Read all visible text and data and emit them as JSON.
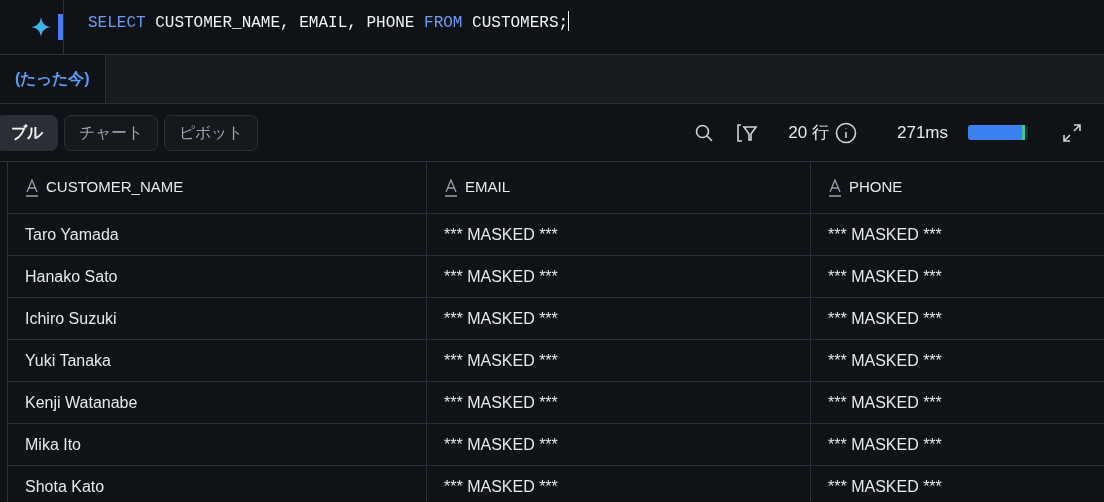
{
  "editor": {
    "query_tokens": [
      {
        "text": "SELECT",
        "kind": "keyword"
      },
      {
        "text": " CUSTOMER_NAME, EMAIL, PHONE ",
        "kind": "plain"
      },
      {
        "text": "FROM",
        "kind": "keyword"
      },
      {
        "text": " CUSTOMERS;",
        "kind": "plain"
      }
    ]
  },
  "result_tabs": [
    {
      "label": "(たった今)",
      "selected": true
    }
  ],
  "view_tabs": [
    {
      "label": "ブル",
      "selected": true
    },
    {
      "label": "チャート",
      "selected": false
    },
    {
      "label": "ピボット",
      "selected": false
    }
  ],
  "toolbar": {
    "row_count": "20 行",
    "duration": "271ms",
    "progress": {
      "level": 0.95
    }
  },
  "table": {
    "columns": [
      "CUSTOMER_NAME",
      "EMAIL",
      "PHONE"
    ],
    "rows": [
      [
        "Taro Yamada",
        "*** MASKED ***",
        "*** MASKED ***"
      ],
      [
        "Hanako Sato",
        "*** MASKED ***",
        "*** MASKED ***"
      ],
      [
        "Ichiro Suzuki",
        "*** MASKED ***",
        "*** MASKED ***"
      ],
      [
        "Yuki Tanaka",
        "*** MASKED ***",
        "*** MASKED ***"
      ],
      [
        "Kenji Watanabe",
        "*** MASKED ***",
        "*** MASKED ***"
      ],
      [
        "Mika Ito",
        "*** MASKED ***",
        "*** MASKED ***"
      ],
      [
        "Shota Kato",
        "*** MASKED ***",
        "*** MASKED ***"
      ]
    ]
  }
}
